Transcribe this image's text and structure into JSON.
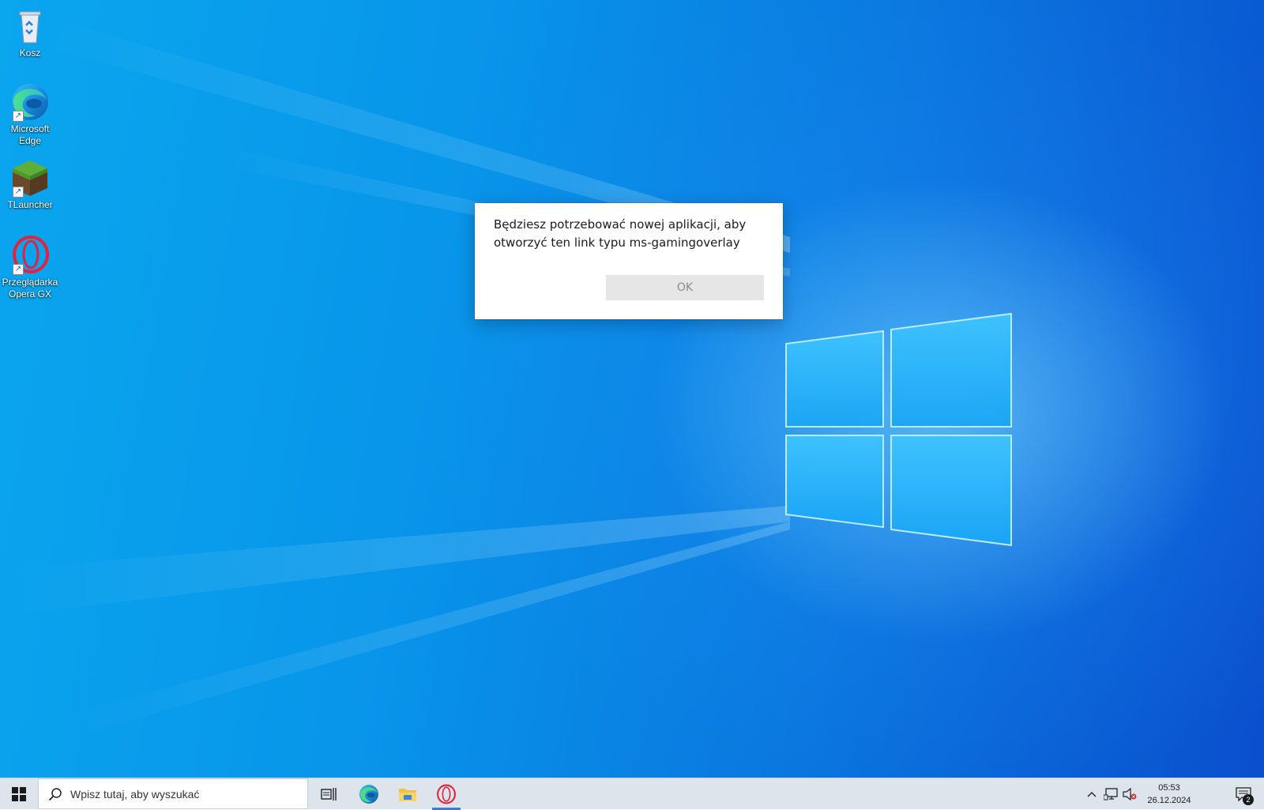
{
  "desktop": {
    "icons": [
      {
        "label": "Kosz",
        "icon": "recycle-bin-icon"
      },
      {
        "label": "Microsoft Edge",
        "icon": "edge-icon"
      },
      {
        "label": "TLauncher",
        "icon": "grass-block-icon"
      },
      {
        "label": "Przeglądarka Opera GX",
        "icon": "opera-gx-icon"
      }
    ]
  },
  "dialog": {
    "message": "Będziesz potrzebować nowej aplikacji, aby otworzyć ten link typu ms-gamingoverlay",
    "ok_label": "OK"
  },
  "taskbar": {
    "search_placeholder": "Wpisz tutaj, aby wyszukać",
    "pinned": [
      {
        "name": "task-view",
        "icon": "task-view-icon"
      },
      {
        "name": "edge",
        "icon": "edge-icon"
      },
      {
        "name": "file-explorer",
        "icon": "folder-icon"
      },
      {
        "name": "opera-gx",
        "icon": "opera-gx-icon",
        "active": true
      }
    ],
    "tray": {
      "time": "05:53",
      "date": "26.12.2024",
      "notification_count": "2"
    }
  },
  "colors": {
    "accent": "#3a7bd5",
    "taskbar_bg": "#dde4ec",
    "opera_red": "#e0243f"
  }
}
